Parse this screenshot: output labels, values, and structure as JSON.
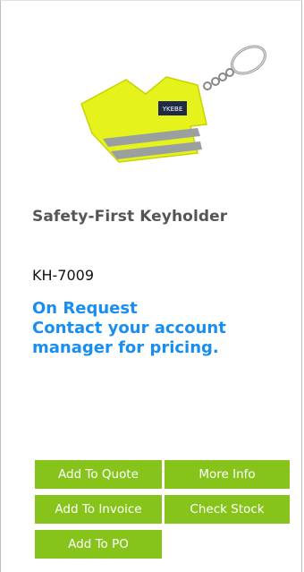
{
  "product": {
    "image_icon": "safety-vest-keyholder-image",
    "vest_logo_text": "YKEBE",
    "name": "Safety-First Keyholder",
    "sku": "KH-7009",
    "availability": "On Request",
    "pricing_note": "Contact your account manager for pricing."
  },
  "actions": {
    "add_to_quote": "Add To Quote",
    "more_info": "More Info",
    "add_to_invoice": "Add To Invoice",
    "check_stock": "Check Stock",
    "add_to_po": "Add To PO"
  },
  "colors": {
    "button_green": "#86c41b",
    "status_blue": "#1a8ef0",
    "name_gray": "#555555",
    "vest_yellow": "#e6f21c"
  }
}
